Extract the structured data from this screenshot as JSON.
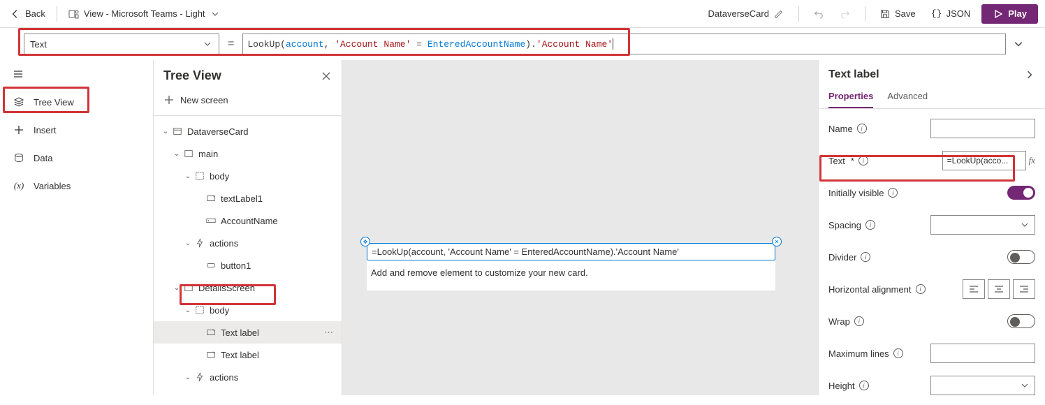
{
  "topbar": {
    "back": "Back",
    "view_label": "View - Microsoft Teams - Light",
    "dataverse_card": "DataverseCard",
    "save": "Save",
    "json": "JSON",
    "play": "Play"
  },
  "formula": {
    "property": "Text",
    "funcname": "LookUp",
    "arg_id": "account",
    "arg_str1": "'Account Name'",
    "arg_kw": "=",
    "arg_id2": "EnteredAccountName",
    "tail": ").",
    "tail_str": "'Account Name'"
  },
  "rail": {
    "tree_view": "Tree View",
    "insert": "Insert",
    "data": "Data",
    "variables": "Variables"
  },
  "treeview": {
    "title": "Tree View",
    "new_screen": "New screen",
    "nodes": {
      "n0": "DataverseCard",
      "n1": "main",
      "n2": "body",
      "n3": "textLabel1",
      "n4": "AccountName",
      "n5": "actions",
      "n6": "button1",
      "n7": "DetailsScreen",
      "n8": "body",
      "n9": "Text label",
      "n10": "Text label",
      "n11": "actions"
    }
  },
  "canvas": {
    "formula_text": "=LookUp(account, 'Account Name' = EnteredAccountName).'Account Name'",
    "hint": "Add and remove element to customize your new card."
  },
  "props": {
    "title": "Text label",
    "tab_properties": "Properties",
    "tab_advanced": "Advanced",
    "name_label": "Name",
    "text_label": "Text",
    "text_required": "*",
    "text_value": "=LookUp(acco...",
    "initially_visible": "Initially visible",
    "spacing": "Spacing",
    "divider": "Divider",
    "halign": "Horizontal alignment",
    "wrap": "Wrap",
    "maxlines": "Maximum lines",
    "height": "Height"
  }
}
